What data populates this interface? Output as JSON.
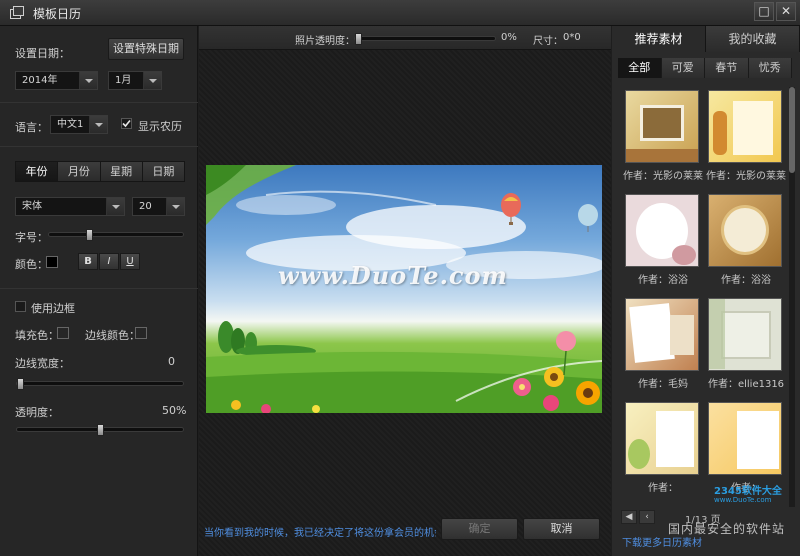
{
  "window": {
    "title": "模板日历",
    "maximize_glyph": "□",
    "close_glyph": "✕"
  },
  "left": {
    "set_date_label": "设置日期：",
    "special_date_button": "设置特殊日期",
    "year_value": "2014年",
    "month_value": "1月",
    "language_label": "语言：",
    "language_value": "中文1",
    "show_lunar_label": "显示农历",
    "show_lunar_checked": true,
    "segments": [
      {
        "label": "年份",
        "active": true
      },
      {
        "label": "月份",
        "active": false
      },
      {
        "label": "星期",
        "active": false
      },
      {
        "label": "日期",
        "active": false
      }
    ],
    "font_value": "宋体",
    "font_size_value": "20",
    "size_label": "字号：",
    "size_level": 0.29,
    "color_label": "颜色：",
    "text_color": "#000000",
    "bold_label": "B",
    "italic_label": "I",
    "underline_label": "U",
    "use_border_label": "使用边框",
    "fill_color_label": "填充色：",
    "border_color_label": "边线颜色：",
    "border_width_label": "边线宽度：",
    "border_width_value": "0",
    "border_width_level": 0,
    "opacity_label": "透明度：",
    "opacity_value": "50%",
    "opacity_level": 0.5
  },
  "center": {
    "photo_opacity_label": "照片透明度：",
    "photo_opacity_value": "0%",
    "photo_opacity_level": 0,
    "size_label": "尺寸：",
    "size_value": "0*0",
    "watermark": "www.DuoTe.com",
    "notice": "当你看到我的时候，我已经决定了将这份拿会员的机会送",
    "confirm_label": "确定",
    "cancel_label": "取消"
  },
  "right": {
    "tabs": [
      {
        "label": "推荐素材",
        "active": true
      },
      {
        "label": "我的收藏",
        "active": false
      }
    ],
    "categories": [
      {
        "label": "全部",
        "active": true
      },
      {
        "label": "可爱",
        "active": false
      },
      {
        "label": "春节",
        "active": false
      },
      {
        "label": "忧秀",
        "active": false
      }
    ],
    "items": [
      {
        "author": "作者：光影の莱莱"
      },
      {
        "author": "作者：光影の莱莱"
      },
      {
        "author": "作者：浴浴"
      },
      {
        "author": "作者：浴浴"
      },
      {
        "author": "作者：毛妈"
      },
      {
        "author": "作者：ellie1316"
      },
      {
        "author": "作者："
      },
      {
        "author": "作者："
      }
    ],
    "page_value": "1/13 页",
    "more_link": "下载更多日历素材"
  },
  "brand": {
    "site": "2345软件大全",
    "slogan": "国内最安全的软件站",
    "url": "www.DuoTe.com"
  }
}
